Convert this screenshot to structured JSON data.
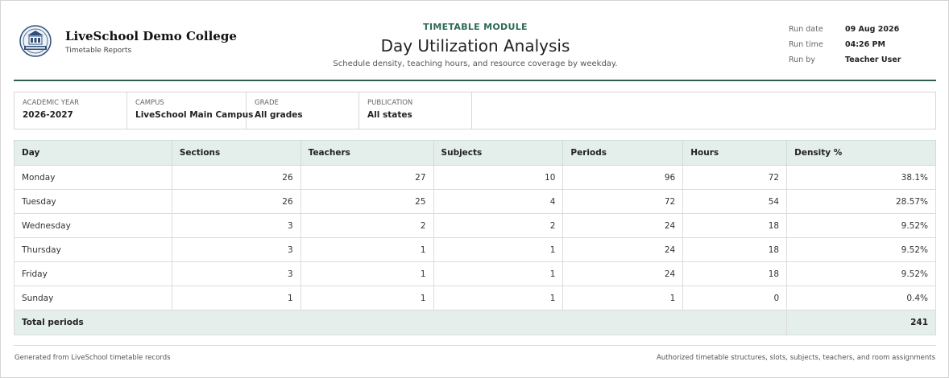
{
  "school": {
    "name": "LiveSchool Demo College",
    "subtitle": "Timetable Reports"
  },
  "report": {
    "module": "TIMETABLE MODULE",
    "title": "Day Utilization Analysis",
    "description": "Schedule density, teaching hours, and resource coverage by weekday."
  },
  "run": {
    "date_label": "Run date",
    "date_value": "09 Aug 2026",
    "time_label": "Run time",
    "time_value": "04:26 PM",
    "by_label": "Run by",
    "by_value": "Teacher User"
  },
  "filters": [
    {
      "label": "ACADEMIC YEAR",
      "value": "2026-2027"
    },
    {
      "label": "CAMPUS",
      "value": "LiveSchool Main Campus"
    },
    {
      "label": "GRADE",
      "value": "All grades"
    },
    {
      "label": "PUBLICATION",
      "value": "All states"
    }
  ],
  "table": {
    "headers": [
      "Day",
      "Sections",
      "Teachers",
      "Subjects",
      "Periods",
      "Hours",
      "Density %"
    ],
    "rows": [
      [
        "Monday",
        "26",
        "27",
        "10",
        "96",
        "72",
        "38.1%"
      ],
      [
        "Tuesday",
        "26",
        "25",
        "4",
        "72",
        "54",
        "28.57%"
      ],
      [
        "Wednesday",
        "3",
        "2",
        "2",
        "24",
        "18",
        "9.52%"
      ],
      [
        "Thursday",
        "3",
        "1",
        "1",
        "24",
        "18",
        "9.52%"
      ],
      [
        "Friday",
        "3",
        "1",
        "1",
        "24",
        "18",
        "9.52%"
      ],
      [
        "Sunday",
        "1",
        "1",
        "1",
        "1",
        "0",
        "0.4%"
      ]
    ],
    "total_label": "Total periods",
    "total_value": "241"
  },
  "footer": {
    "left": "Generated from LiveSchool timetable records",
    "right": "Authorized timetable structures, slots, subjects, teachers, and room assignments"
  },
  "colors": {
    "accent": "#2e6b55",
    "header_rule": "#2e5e4e",
    "table_header_bg": "#e4eeeb"
  },
  "icons": {
    "logo": "school-crest-icon"
  }
}
